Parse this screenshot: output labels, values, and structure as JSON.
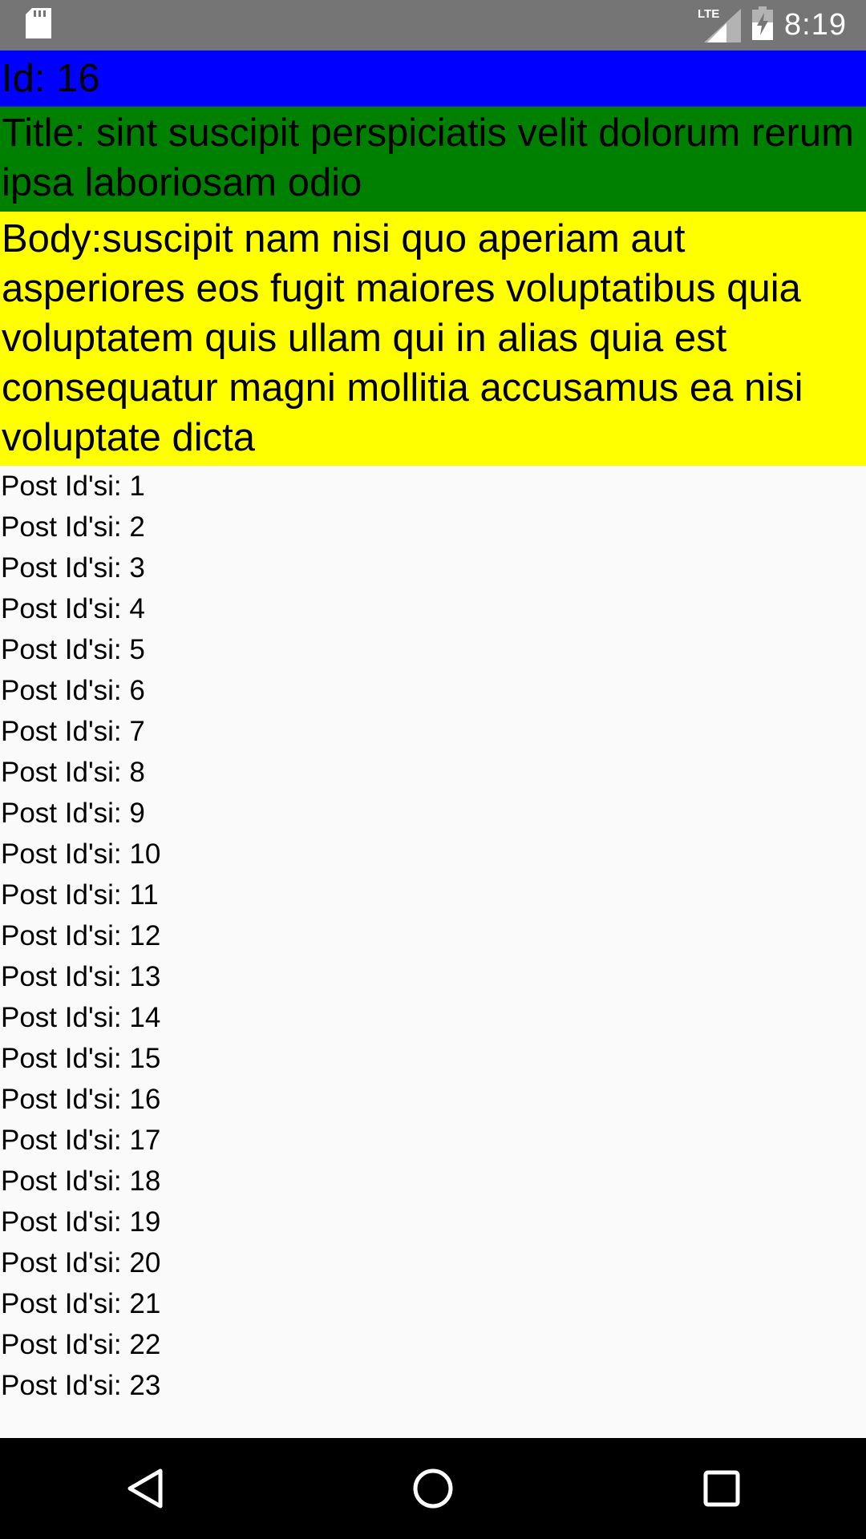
{
  "status_bar": {
    "time": "8:19",
    "network_label": "LTE",
    "icons": [
      "sd-card-icon",
      "signal-icon",
      "battery-charging-icon"
    ]
  },
  "detail": {
    "id_text": "Id: 16",
    "title_text": "Title: sint suscipit perspiciatis velit dolorum rerum ipsa laboriosam odio",
    "body_text": "Body:suscipit nam nisi quo aperiam aut asperiores eos fugit maiores voluptatibus quia\nvoluptatem quis ullam qui in alias quia est consequatur magni mollitia accusamus ea nisi voluptate dicta"
  },
  "colors": {
    "id_background": "#0000ff",
    "title_background": "#008000",
    "body_background": "#ffff00",
    "list_background": "#fafafa",
    "status_bar": "#757575",
    "nav_bar": "#000000"
  },
  "post_list": {
    "items": [
      "Post Id'si: 1",
      "Post Id'si: 2",
      "Post Id'si: 3",
      "Post Id'si: 4",
      "Post Id'si: 5",
      "Post Id'si: 6",
      "Post Id'si: 7",
      "Post Id'si: 8",
      "Post Id'si: 9",
      "Post Id'si: 10",
      "Post Id'si: 11",
      "Post Id'si: 12",
      "Post Id'si: 13",
      "Post Id'si: 14",
      "Post Id'si: 15",
      "Post Id'si: 16",
      "Post Id'si: 17",
      "Post Id'si: 18",
      "Post Id'si: 19",
      "Post Id'si: 20",
      "Post Id'si: 21",
      "Post Id'si: 22",
      "Post Id'si: 23"
    ]
  },
  "nav_bar": {
    "buttons": [
      "back-icon",
      "home-icon",
      "recents-icon"
    ]
  }
}
